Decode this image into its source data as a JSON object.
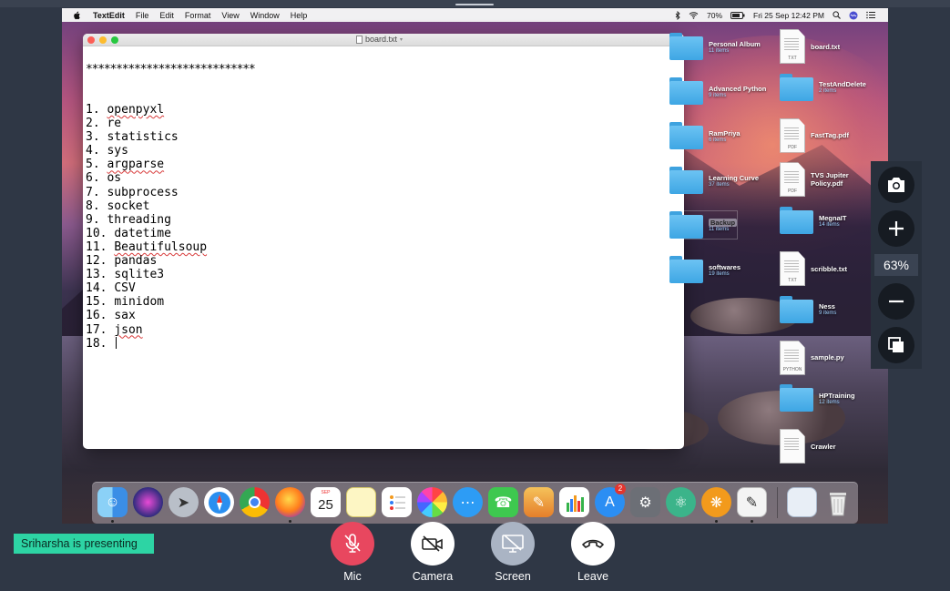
{
  "menubar": {
    "app": "TextEdit",
    "items": [
      "File",
      "Edit",
      "Format",
      "View",
      "Window",
      "Help"
    ],
    "battery": "70%",
    "datetime": "Fri 25 Sep  12:42 PM"
  },
  "textedit": {
    "title": "board.txt",
    "stars": "****************************",
    "lines": [
      {
        "num": "1.",
        "text": "openpyxl",
        "squiggle": true
      },
      {
        "num": "2.",
        "text": "re",
        "squiggle": false
      },
      {
        "num": "3.",
        "text": "statistics",
        "squiggle": false
      },
      {
        "num": "4.",
        "text": "sys",
        "squiggle": false
      },
      {
        "num": "5.",
        "text": "argparse",
        "squiggle": true
      },
      {
        "num": "6.",
        "text": "os",
        "squiggle": false
      },
      {
        "num": "7.",
        "text": "subprocess",
        "squiggle": false
      },
      {
        "num": "8.",
        "text": "socket",
        "squiggle": false
      },
      {
        "num": "9.",
        "text": "threading",
        "squiggle": false
      },
      {
        "num": "10.",
        "text": "datetime",
        "squiggle": false
      },
      {
        "num": "11.",
        "text": "Beautifulsoup",
        "squiggle": true
      },
      {
        "num": "12.",
        "text": "pandas",
        "squiggle": false
      },
      {
        "num": "13.",
        "text": "sqlite3",
        "squiggle": false
      },
      {
        "num": "14.",
        "text": "CSV",
        "squiggle": false
      },
      {
        "num": "15.",
        "text": "minidom",
        "squiggle": false
      },
      {
        "num": "16.",
        "text": "sax",
        "squiggle": false
      },
      {
        "num": "17.",
        "text": "json",
        "squiggle": true
      },
      {
        "num": "18.",
        "text": "",
        "squiggle": false
      }
    ]
  },
  "desktop": {
    "left_column": [
      {
        "name": "Personal Album",
        "count": "11 items",
        "kind": "folder"
      },
      {
        "name": "Advanced Python",
        "count": "9 items",
        "kind": "folder"
      },
      {
        "name": "RamPriya",
        "count": "6 items",
        "kind": "folder"
      },
      {
        "name": "Learning Curve",
        "count": "37 items",
        "kind": "folder"
      },
      {
        "name": "Backup",
        "count": "11 items",
        "kind": "folder"
      },
      {
        "name": "softwares",
        "count": "19 items",
        "kind": "folder"
      }
    ],
    "right_column": [
      {
        "name": "board.txt",
        "count": "",
        "kind": "doc",
        "tag": "TXT"
      },
      {
        "name": "TestAndDelete",
        "count": "2 items",
        "kind": "folder",
        "tag": ""
      },
      {
        "name": "FastTag.pdf",
        "count": "",
        "kind": "doc",
        "tag": "PDF"
      },
      {
        "name": "TVS Jupiter Policy.pdf",
        "count": "",
        "kind": "doc",
        "tag": "PDF"
      },
      {
        "name": "MegnaIT",
        "count": "14 items",
        "kind": "folder",
        "tag": ""
      },
      {
        "name": "scribble.txt",
        "count": "",
        "kind": "doc",
        "tag": "TXT"
      },
      {
        "name": "Ness",
        "count": "9 items",
        "kind": "folder",
        "tag": ""
      },
      {
        "name": "sample.py",
        "count": "",
        "kind": "doc",
        "tag": "PYTHON"
      },
      {
        "name": "HPTraining",
        "count": "12 items",
        "kind": "folder",
        "tag": ""
      },
      {
        "name": "Crawler",
        "count": "",
        "kind": "doc",
        "tag": ""
      }
    ]
  },
  "dock": {
    "calendar_month": "SEP",
    "calendar_day": "25",
    "appstore_badge": "2"
  },
  "zoom": {
    "level": "63%"
  },
  "meeting": {
    "presenter_text": "Sriharsha is presenting",
    "controls": {
      "mic": "Mic",
      "camera": "Camera",
      "screen": "Screen",
      "leave": "Leave"
    },
    "colors": {
      "mic": "#e8475f",
      "camera": "#ffffff",
      "screen": "#aab4c4",
      "leave": "#ffffff",
      "presenter_badge": "#2dd4a4"
    }
  }
}
